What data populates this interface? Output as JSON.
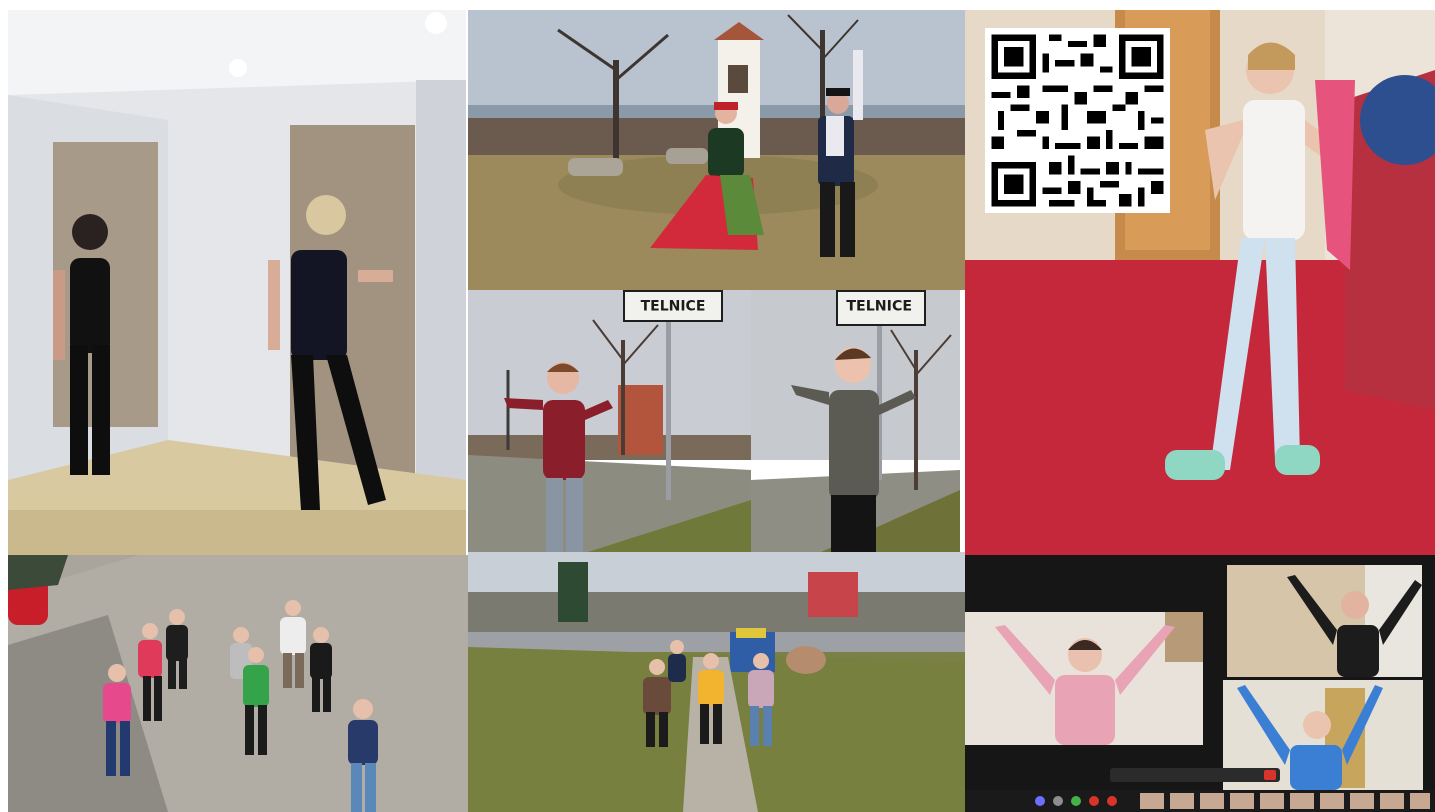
{
  "collage": {
    "signs": {
      "left_sign": "TELNICE",
      "right_sign": "TELNICE"
    },
    "qr_code_icon": "qr-code-icon"
  }
}
